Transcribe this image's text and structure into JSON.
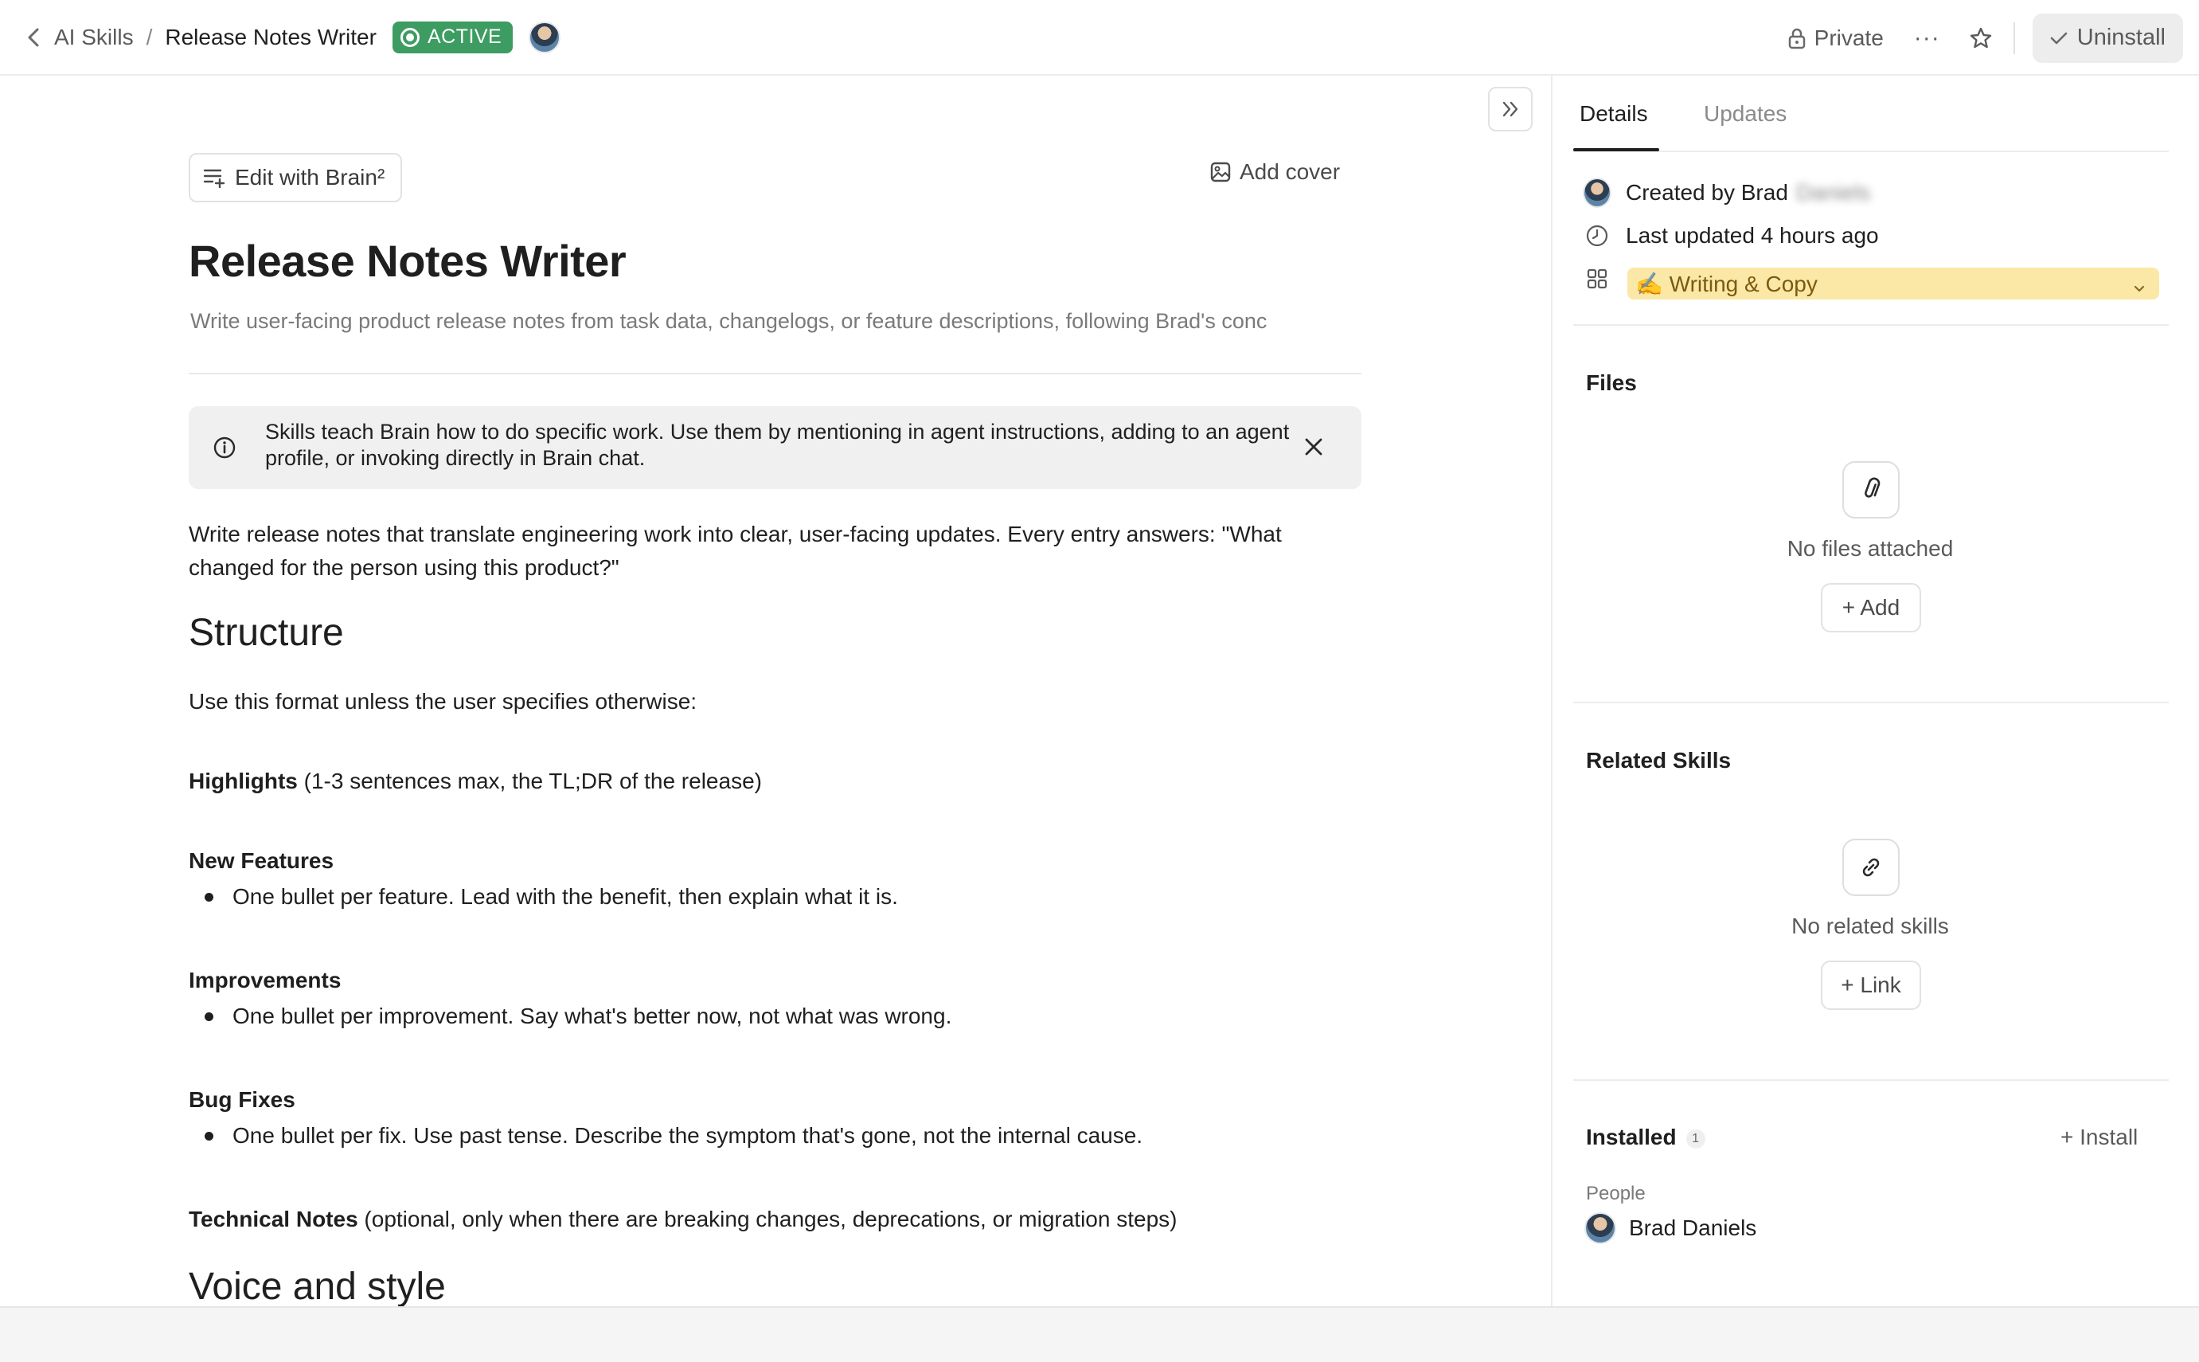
{
  "breadcrumb": {
    "parent": "AI Skills",
    "separator": "/",
    "current": "Release Notes Writer",
    "status_badge": "ACTIVE"
  },
  "header": {
    "privacy_label": "Private",
    "more_label": "···",
    "uninstall_label": "Uninstall"
  },
  "doc": {
    "edit_button": "Edit with Brain²",
    "add_cover": "Add cover",
    "title": "Release Notes Writer",
    "description": "Write user-facing product release notes from task data, changelogs, or feature descriptions, following Brad's conc",
    "info_text": "Skills teach Brain how to do specific work. Use them by mentioning in agent instructions, adding to an agent profile, or invoking directly in Brain chat.",
    "intro": "Write release notes that translate engineering work into clear, user-facing updates. Every entry answers: \"What changed for the person using this product?\"",
    "structure_heading": "Structure",
    "structure_intro": "Use this format unless the user specifies otherwise:",
    "highlights_label": "Highlights",
    "highlights_text": " (1-3 sentences max, the TL;DR of the release)",
    "new_features_label": "New Features",
    "new_features_bullet": "One bullet per feature. Lead with the benefit, then explain what it is.",
    "improvements_label": "Improvements",
    "improvements_bullet": "One bullet per improvement. Say what's better now, not what was wrong.",
    "bug_fixes_label": "Bug Fixes",
    "bug_fixes_bullet": "One bullet per fix. Use past tense. Describe the symptom that's gone, not the internal cause.",
    "technical_notes_label": "Technical Notes",
    "technical_notes_text": " (optional, only when there are breaking changes, deprecations, or migration steps)",
    "voice_heading": "Voice and style"
  },
  "panel": {
    "tabs": [
      {
        "label": "Details",
        "active": true
      },
      {
        "label": "Updates",
        "active": false
      }
    ],
    "created_by_prefix": "Created by Brad",
    "created_by_blurred": "Daniels",
    "last_updated": "Last updated 4 hours ago",
    "category": "✍️ Writing & Copy",
    "files_title": "Files",
    "files_empty": "No files attached",
    "files_add": "+ Add",
    "related_title": "Related Skills",
    "related_empty": "No related skills",
    "related_link": "+ Link",
    "installed_title": "Installed",
    "installed_count": "1",
    "install_link": "+ Install",
    "people_label": "People",
    "person_name": "Brad Daniels"
  },
  "colors": {
    "active_badge": "#3d9c61",
    "category_bg": "#fbe8a6",
    "info_bg": "#f0f0f0"
  }
}
